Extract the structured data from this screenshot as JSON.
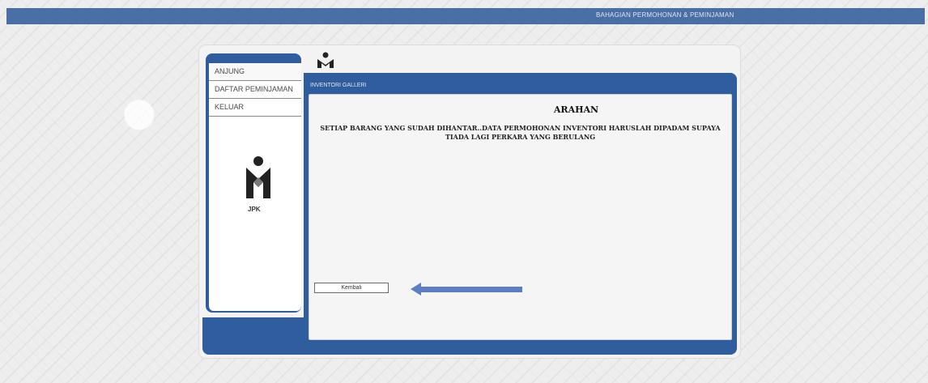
{
  "header": {
    "title": "BAHAGIAN PERMOHONAN & PEMINJAMAN"
  },
  "sidebar": {
    "items": [
      {
        "label": "ANJUNG"
      },
      {
        "label": "DAFTAR PEMINJAMAN"
      },
      {
        "label": "KELUAR"
      }
    ],
    "logo_caption": "JPK"
  },
  "content": {
    "tab_label": "INVENTORI  GALLERI",
    "heading": "ARAHAN",
    "message": "SETIAP BARANG YANG SUDAH DIHANTAR..DATA PERMOHONAN INVENTORI HARUSLAH DIPADAM SUPAYA TIADA LAGI PERKARA YANG BERULANG",
    "back_button_label": "Kembali"
  },
  "icons": {
    "logo": "jpk-logo-icon",
    "arrow": "arrow-left-icon"
  },
  "colors": {
    "top_bar": "#4a6fa5",
    "panel_blue": "#2f5d9e",
    "arrow": "#5b7fc7"
  }
}
